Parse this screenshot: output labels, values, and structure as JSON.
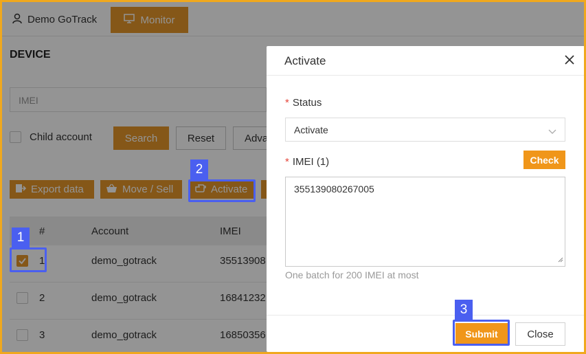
{
  "topbar": {
    "user_name": "Demo GoTrack",
    "monitor_label": "Monitor"
  },
  "page": {
    "title": "DEVICE"
  },
  "filter": {
    "imei_placeholder": "IMEI",
    "child_account_label": "Child account",
    "search_label": "Search",
    "reset_label": "Reset",
    "advanced_label": "Adva"
  },
  "toolbar": {
    "export_label": "Export data",
    "move_sell_label": "Move / Sell",
    "activate_label": "Activate"
  },
  "table": {
    "headers": {
      "num": "#",
      "account": "Account",
      "imei": "IMEI"
    },
    "rows": [
      {
        "num": "1",
        "account": "demo_gotrack",
        "imei": "35513908",
        "checked": true
      },
      {
        "num": "2",
        "account": "demo_gotrack",
        "imei": "16841232",
        "checked": false
      },
      {
        "num": "3",
        "account": "demo_gotrack",
        "imei": "16850356",
        "checked": false
      }
    ]
  },
  "modal": {
    "title": "Activate",
    "status_label": "Status",
    "status_value": "Activate",
    "imei_label": "IMEI (1)",
    "check_label": "Check",
    "imei_value": "355139080267005",
    "hint": "One batch for 200 IMEI at most",
    "submit_label": "Submit",
    "close_label": "Close"
  },
  "annotations": {
    "step1": "1",
    "step2": "2",
    "step3": "3"
  },
  "colors": {
    "accent": "#e5962a",
    "highlight": "#4a5ff0",
    "frame": "#f0a81e"
  }
}
